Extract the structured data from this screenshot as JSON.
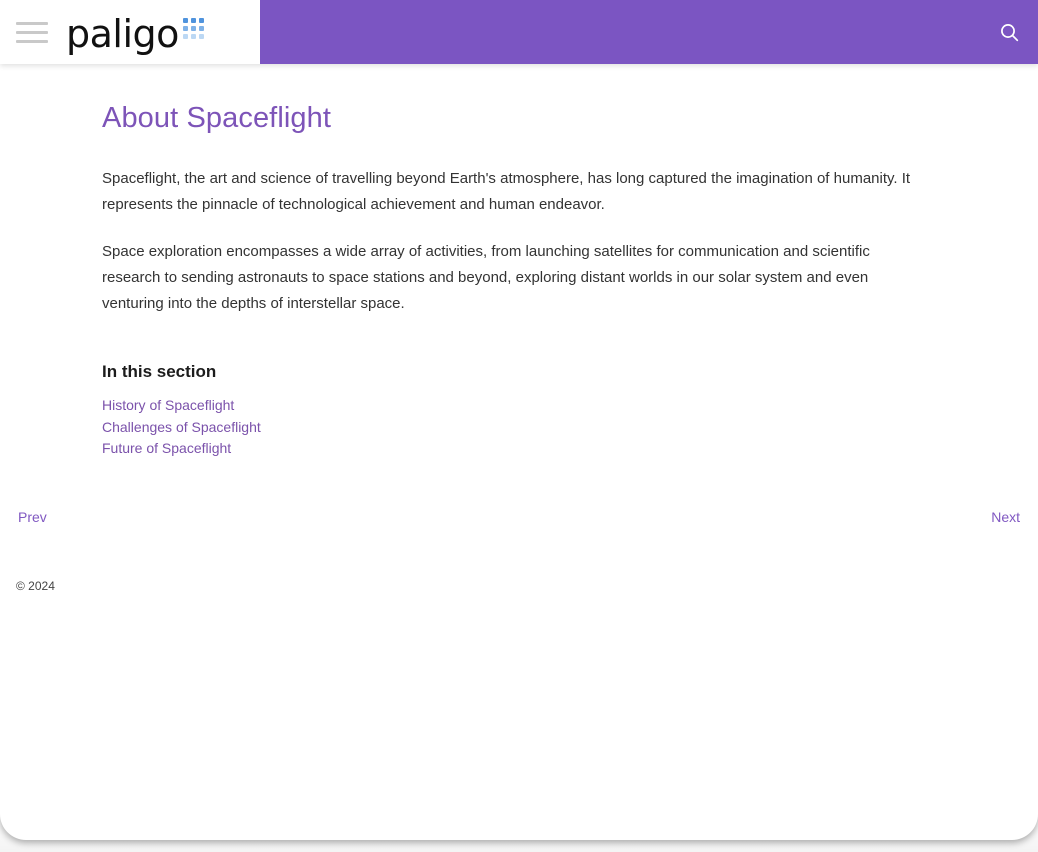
{
  "colors": {
    "brand_purple": "#7b55c2",
    "heading_purple": "#7d54b8",
    "link_purple": "#7b52ab",
    "pager_purple": "#8159c2",
    "body_text": "#333333",
    "logo_text": "#111111",
    "hamburger_grey": "#c9c9c9",
    "logo_dot_row1": "#4f93dd",
    "logo_dot_row2": "#7fb2e8",
    "logo_dot_row3": "#bcd8f4"
  },
  "header": {
    "menu_icon": "hamburger-menu-icon",
    "logo_text": "paligo",
    "logo_mark": "dot-grid-icon",
    "search_icon": "search-icon",
    "search_label": "Search"
  },
  "main": {
    "title": "About Spaceflight",
    "paragraphs": [
      "Spaceflight, the art and science of travelling beyond Earth's atmosphere, has long captured the imagination of humanity. It represents the pinnacle of technological achievement and human endeavor.",
      "Space exploration encompasses a wide array of activities, from launching satellites for communication and scientific research to sending astronauts to space stations and beyond, exploring distant worlds in our solar system and even venturing into the depths of interstellar space."
    ],
    "section_heading": "In this section",
    "section_links": [
      "History of Spaceflight",
      "Challenges of Spaceflight",
      "Future of Spaceflight"
    ]
  },
  "pager": {
    "prev_label": "Prev",
    "next_label": "Next"
  },
  "footer": {
    "copyright": "© 2024"
  }
}
